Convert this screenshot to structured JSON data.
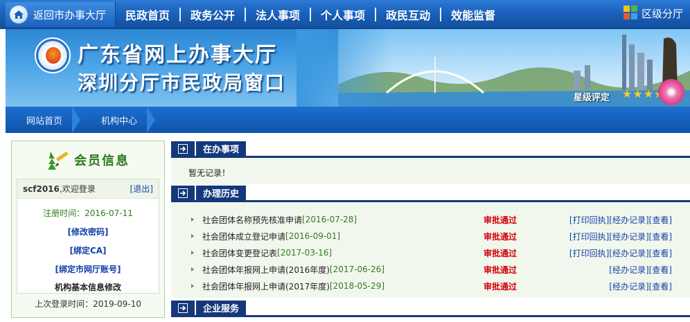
{
  "topnav": {
    "home_label": "返回市办事大厅",
    "items": [
      "民政首页",
      "政务公开",
      "法人事项",
      "个人事项",
      "政民互动",
      "效能监督"
    ],
    "district_label": "区级分厅"
  },
  "banner": {
    "title_line1": "广东省网上办事大厅",
    "title_line2": "深圳分厅市民政局窗口",
    "rating_label": "星级评定",
    "stars": "★★★★★"
  },
  "breadcrumb": [
    "网站首页",
    "机构中心"
  ],
  "member": {
    "title": "会员信息",
    "username": "scf2016",
    "welcome": ",欢迎登录",
    "logout": "[退出]",
    "reg_time": "注册时间：2016-07-11",
    "link_password": "[修改密码]",
    "link_ca": "[绑定CA]",
    "link_account": "[绑定市网厅账号]",
    "link_info": "机构基本信息修改",
    "last_login": "上次登录时间：2019-09-10"
  },
  "sections": {
    "in_progress": "在办事项",
    "empty_text": "暂无记录！",
    "history": "办理历史",
    "enterprise": "企业服务"
  },
  "history_items": [
    {
      "name": "社会团体名称预先核准申请",
      "date": "[2016-07-28]",
      "status": "审批通过",
      "actions": "[打印回执][经办记录][查看]"
    },
    {
      "name": "社会团体成立登记申请",
      "date": "[2016-09-01]",
      "status": "审批通过",
      "actions": "[打印回执][经办记录][查看]"
    },
    {
      "name": "社会团体变更登记表",
      "date": "[2017-03-16]",
      "status": "审批通过",
      "actions": "[打印回执][经办记录][查看]"
    },
    {
      "name": "社会团体年报网上申请(2016年度)",
      "date": "[2017-06-26]",
      "status": "审批通过",
      "actions": "[经办记录][查看]"
    },
    {
      "name": "社会团体年报网上申请(2017年度)",
      "date": "[2018-05-29]",
      "status": "审批通过",
      "actions": "[经办记录][查看]"
    }
  ],
  "colors": {
    "nav_blue": "#1a5fb8",
    "section_navy": "#15387a",
    "status_red": "#d4000a",
    "date_green": "#2e7d1d",
    "link_blue": "#1540a8"
  }
}
